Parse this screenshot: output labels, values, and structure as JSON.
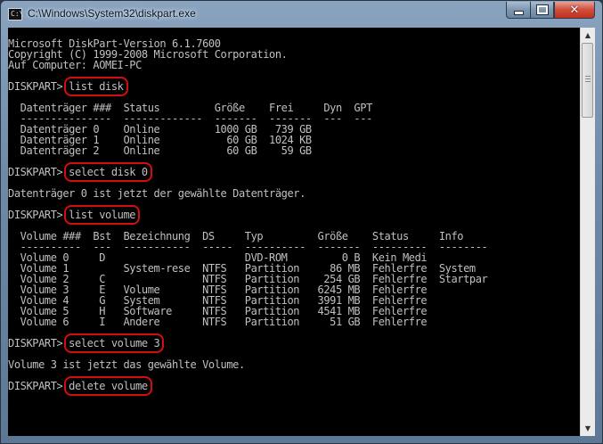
{
  "window": {
    "title": "C:\\Windows\\System32\\diskpart.exe",
    "icon": "console-icon",
    "icon_glyph": "C:\\",
    "controls": {
      "minimize": "minimize-icon",
      "maximize": "maximize-icon",
      "close": "close-icon",
      "close_color": "#c7311d"
    }
  },
  "console": {
    "text_color": "#c0c0c0",
    "background_color": "#000000",
    "highlight_color": "#d01010",
    "lines": [
      {
        "text": "Microsoft DiskPart-Version 6.1.7600"
      },
      {
        "text": "Copyright (C) 1999-2008 Microsoft Corporation."
      },
      {
        "text": "Auf Computer: AOMEI-PC"
      },
      {
        "text": ""
      },
      {
        "prompt": "DISKPART> ",
        "command": "list disk"
      },
      {
        "text": ""
      },
      {
        "text": "  Datenträger ###  Status         Größe    Frei     Dyn  GPT"
      },
      {
        "text": "  ---------------  -------------  -------  -------  ---  ---"
      },
      {
        "text": "  Datenträger 0    Online         1000 GB   739 GB"
      },
      {
        "text": "  Datenträger 1    Online           60 GB  1024 KB"
      },
      {
        "text": "  Datenträger 2    Online           60 GB    59 GB"
      },
      {
        "text": ""
      },
      {
        "prompt": "DISKPART> ",
        "command": "select disk 0"
      },
      {
        "text": ""
      },
      {
        "text": "Datenträger 0 ist jetzt der gewählte Datenträger."
      },
      {
        "text": ""
      },
      {
        "prompt": "DISKPART> ",
        "command": "list volume"
      },
      {
        "text": ""
      },
      {
        "text": "  Volume ###  Bst  Bezeichnung  DS     Typ         Größe    Status     Info"
      },
      {
        "text": "  ----------  ---  -----------  -----  ----------  -------  ---------  --------"
      },
      {
        "text": "  Volume 0     D                       DVD-ROM         0 B  Kein Medi"
      },
      {
        "text": "  Volume 1         System-rese  NTFS   Partition     86 MB  Fehlerfre  System"
      },
      {
        "text": "  Volume 2     C                NTFS   Partition    254 GB  Fehlerfre  Startpar"
      },
      {
        "text": "  Volume 3     E   Volume       NTFS   Partition   6245 MB  Fehlerfre"
      },
      {
        "text": "  Volume 4     G   System       NTFS   Partition   3991 MB  Fehlerfre"
      },
      {
        "text": "  Volume 5     H   Software     NTFS   Partition   4541 MB  Fehlerfre"
      },
      {
        "text": "  Volume 6     I   Andere       NTFS   Partition     51 GB  Fehlerfre"
      },
      {
        "text": ""
      },
      {
        "prompt": "DISKPART> ",
        "command": "select volume 3"
      },
      {
        "text": ""
      },
      {
        "text": "Volume 3 ist jetzt das gewählte Volume."
      },
      {
        "text": ""
      },
      {
        "prompt": "DISKPART> ",
        "command": "delete volume"
      }
    ]
  },
  "scrollbar": {
    "up_arrow": "▲",
    "down_arrow": "▼",
    "position": 0.0
  }
}
